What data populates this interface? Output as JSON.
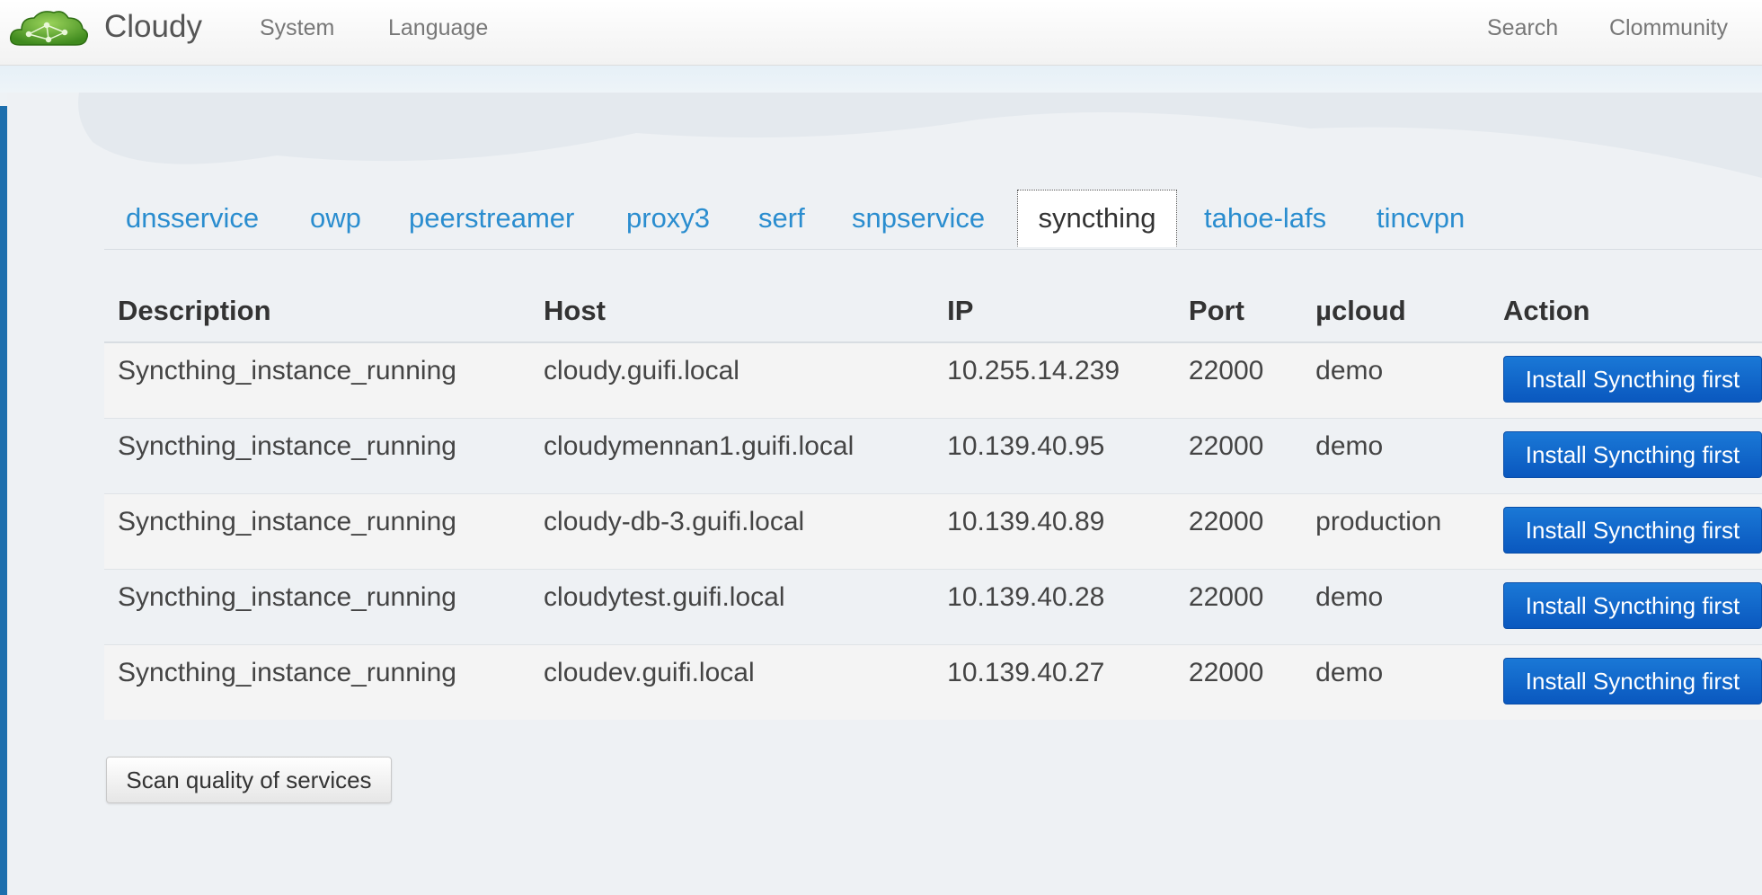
{
  "header": {
    "brand": "Cloudy",
    "nav_left": [
      "System",
      "Language"
    ],
    "nav_right": [
      "Search",
      "Clommunity"
    ]
  },
  "tabs": {
    "items": [
      "dnsservice",
      "owp",
      "peerstreamer",
      "proxy3",
      "serf",
      "snpservice",
      "syncthing",
      "tahoe-lafs",
      "tincvpn"
    ],
    "active": "syncthing"
  },
  "table": {
    "columns": [
      "Description",
      "Host",
      "IP",
      "Port",
      "µcloud",
      "Action"
    ],
    "rows": [
      {
        "description": "Syncthing_instance_running",
        "host": "cloudy.guifi.local",
        "ip": "10.255.14.239",
        "port": "22000",
        "cloud": "demo",
        "action": "Install Syncthing first"
      },
      {
        "description": "Syncthing_instance_running",
        "host": "cloudymennan1.guifi.local",
        "ip": "10.139.40.95",
        "port": "22000",
        "cloud": "demo",
        "action": "Install Syncthing first"
      },
      {
        "description": "Syncthing_instance_running",
        "host": "cloudy-db-3.guifi.local",
        "ip": "10.139.40.89",
        "port": "22000",
        "cloud": "production",
        "action": "Install Syncthing first"
      },
      {
        "description": "Syncthing_instance_running",
        "host": "cloudytest.guifi.local",
        "ip": "10.139.40.28",
        "port": "22000",
        "cloud": "demo",
        "action": "Install Syncthing first"
      },
      {
        "description": "Syncthing_instance_running",
        "host": "cloudev.guifi.local",
        "ip": "10.139.40.27",
        "port": "22000",
        "cloud": "demo",
        "action": "Install Syncthing first"
      }
    ]
  },
  "scan_button": "Scan quality of services",
  "colors": {
    "accent": "#2a8dcf",
    "button_primary": "#0a62c9",
    "left_bar": "#1d6fad"
  }
}
